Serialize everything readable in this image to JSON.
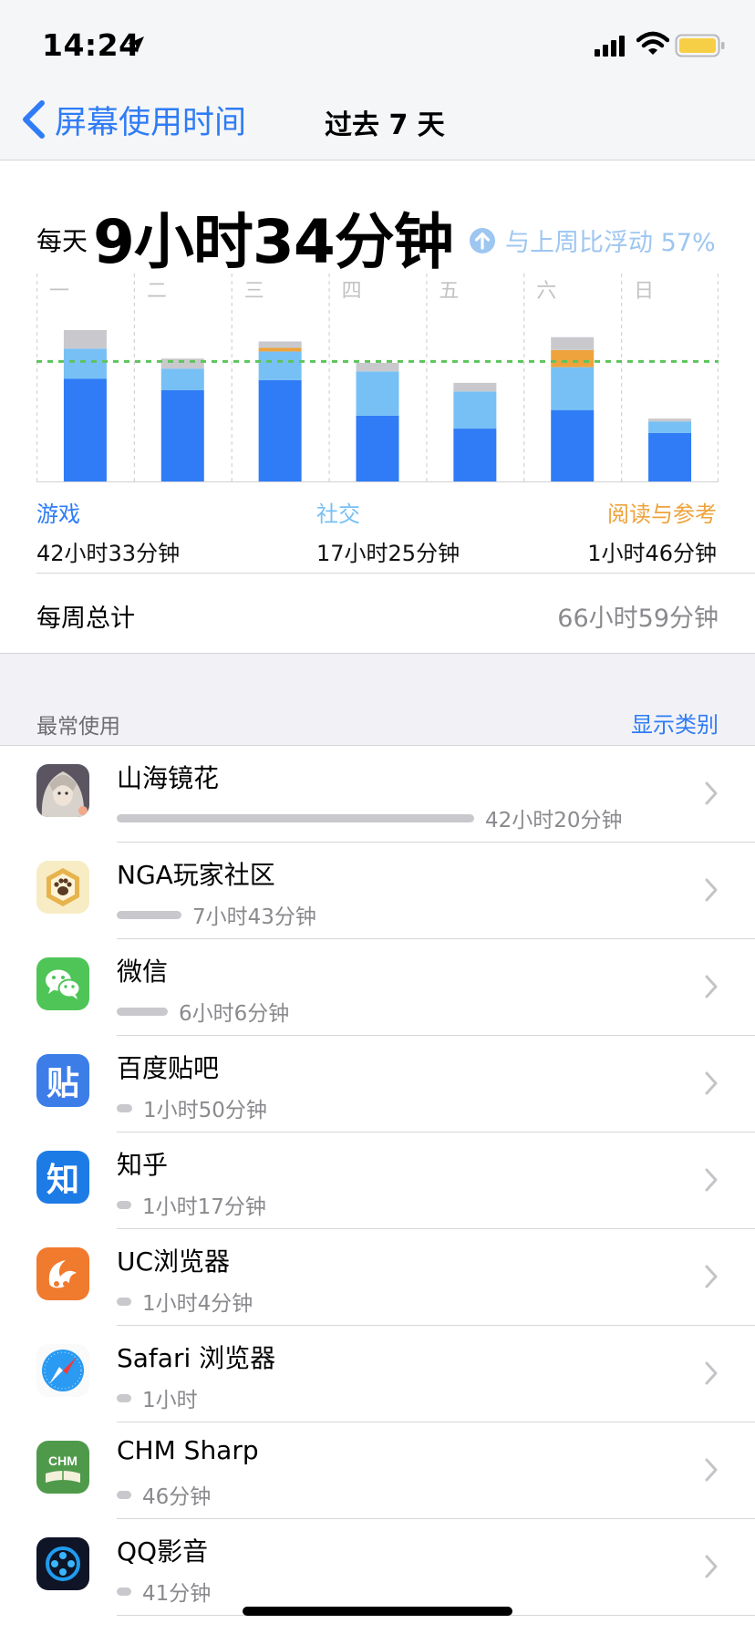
{
  "status_bar": {
    "time": "14:24"
  },
  "nav": {
    "back_label": "屏幕使用时间",
    "title": "过去 7 天"
  },
  "summary": {
    "daily_prefix": "每天",
    "daily_value": "9小时34分钟",
    "trend_text": "与上周比浮动 57%",
    "trend_direction": "up"
  },
  "colors": {
    "games": "#2f7cf6",
    "social": "#76c0f5",
    "reading": "#eea33c",
    "other": "#c9c9cd",
    "average_line": "#5cc45a",
    "accent": "#2f7cf6"
  },
  "chart_data": {
    "type": "bar",
    "stacked": true,
    "categories": [
      "一",
      "二",
      "三",
      "四",
      "五",
      "六",
      "日"
    ],
    "series": [
      {
        "name": "游戏",
        "values": [
          7.2,
          6.4,
          7.1,
          4.6,
          3.7,
          5.0,
          3.4
        ]
      },
      {
        "name": "社交",
        "values": [
          2.1,
          1.5,
          2.0,
          3.1,
          2.6,
          3.0,
          0.8
        ]
      },
      {
        "name": "阅读与参考",
        "values": [
          0,
          0,
          0.25,
          0,
          0,
          1.2,
          0
        ]
      },
      {
        "name": "其他",
        "values": [
          1.3,
          0.7,
          0.45,
          0.6,
          0.6,
          0.9,
          0.2
        ]
      }
    ],
    "average": 8.4,
    "ylim": [
      0,
      12
    ],
    "grid": true
  },
  "legend": [
    {
      "category": "游戏",
      "total": "42小时33分钟"
    },
    {
      "category": "社交",
      "total": "17小时25分钟"
    },
    {
      "category": "阅读与参考",
      "total": "1小时46分钟"
    }
  ],
  "weekly": {
    "label": "每周总计",
    "value": "66小时59分钟"
  },
  "most_used": {
    "label": "最常使用",
    "show_categories": "显示类别",
    "apps": [
      {
        "name": "山海镜花",
        "time": "42小时20分钟",
        "fraction": 1.0,
        "icon": "shanhai-app-icon"
      },
      {
        "name": "NGA玩家社区",
        "time": "7小时43分钟",
        "fraction": 0.18,
        "icon": "nga-app-icon"
      },
      {
        "name": "微信",
        "time": "6小时6分钟",
        "fraction": 0.144,
        "icon": "wechat-app-icon"
      },
      {
        "name": "百度贴吧",
        "time": "1小时50分钟",
        "fraction": 0.043,
        "icon": "tieba-app-icon",
        "glyph": "贴"
      },
      {
        "name": "知乎",
        "time": "1小时17分钟",
        "fraction": 0.03,
        "icon": "zhihu-app-icon",
        "glyph": "知"
      },
      {
        "name": "UC浏览器",
        "time": "1小时4分钟",
        "fraction": 0.025,
        "icon": "uc-browser-app-icon"
      },
      {
        "name": "Safari 浏览器",
        "time": "1小时",
        "fraction": 0.024,
        "icon": "safari-app-icon"
      },
      {
        "name": "CHM Sharp",
        "time": "46分钟",
        "fraction": 0.018,
        "icon": "chm-sharp-app-icon",
        "glyph": "CHM"
      },
      {
        "name": "QQ影音",
        "time": "41分钟",
        "fraction": 0.016,
        "icon": "qq-player-app-icon"
      }
    ]
  }
}
